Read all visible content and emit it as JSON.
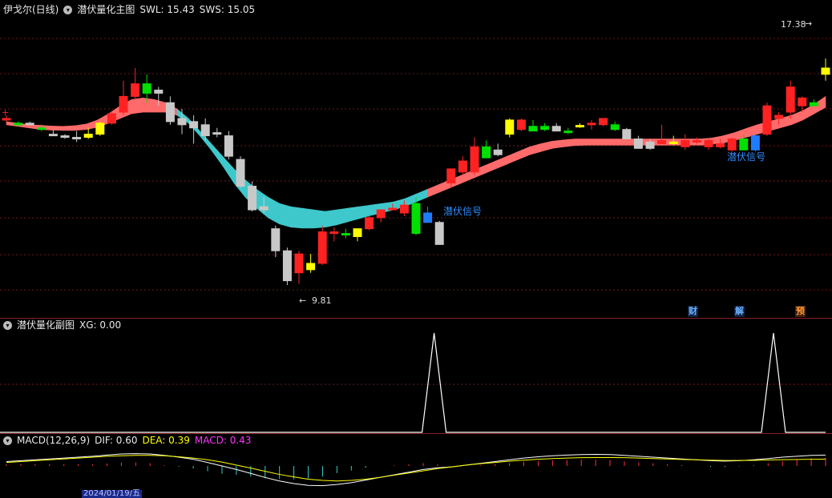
{
  "main_header": {
    "stock_name": "伊戈尔(日线)",
    "indicator_name": "潜伏量化主图",
    "swl_label": "SWL: 15.43",
    "sws_label": "SWS: 15.05"
  },
  "sub_header": {
    "indicator_name": "潜伏量化副图",
    "xg_label": "XG: 0.00"
  },
  "macd_header": {
    "name": "MACD(12,26,9)",
    "dif_label": "DIF: 0.60",
    "dea_label": "DEA: 0.39",
    "macd_label": "MACD: 0.43"
  },
  "annotations": {
    "high_label": "17.38",
    "low_label": "9.81",
    "signal_1": "潜伏信号",
    "signal_2": "潜伏信号"
  },
  "badges": [
    "财",
    "解",
    "预"
  ],
  "bottom_date": "2024/01/19/五",
  "colors": {
    "up": "#ff2222",
    "down": "#c8c8c8",
    "yellow": "#ffff00",
    "green": "#00e000",
    "blue": "#1e7cff",
    "ribbon_up": "#ff6b6b",
    "ribbon_down": "#3ec8cc",
    "signal_text": "#2e8cff"
  },
  "chart_data": {
    "type": "candlestick",
    "price_range": [
      9.0,
      18.3
    ],
    "candles": [
      {
        "o": 15.1,
        "h": 15.2,
        "l": 15.0,
        "c": 15.1,
        "col": "up"
      },
      {
        "o": 14.9,
        "h": 15.0,
        "l": 14.85,
        "c": 14.95,
        "col": "green"
      },
      {
        "o": 14.95,
        "h": 15.0,
        "l": 14.9,
        "c": 14.95,
        "col": "down"
      },
      {
        "o": 14.75,
        "h": 14.9,
        "l": 14.7,
        "c": 14.8,
        "col": "green"
      },
      {
        "o": 14.6,
        "h": 14.75,
        "l": 14.55,
        "c": 14.55,
        "col": "down"
      },
      {
        "o": 14.5,
        "h": 14.6,
        "l": 14.45,
        "c": 14.55,
        "col": "down"
      },
      {
        "o": 14.48,
        "h": 14.7,
        "l": 14.35,
        "c": 14.5,
        "col": "down"
      },
      {
        "o": 14.5,
        "h": 14.8,
        "l": 14.45,
        "c": 14.6,
        "col": "yellow"
      },
      {
        "o": 14.6,
        "h": 15.0,
        "l": 14.55,
        "c": 14.95,
        "col": "yellow"
      },
      {
        "o": 14.95,
        "h": 15.3,
        "l": 14.9,
        "c": 15.25,
        "col": "up"
      },
      {
        "o": 15.3,
        "h": 16.3,
        "l": 15.2,
        "c": 15.8,
        "col": "up"
      },
      {
        "o": 15.8,
        "h": 16.7,
        "l": 15.7,
        "c": 16.2,
        "col": "up"
      },
      {
        "o": 16.2,
        "h": 16.5,
        "l": 15.6,
        "c": 15.9,
        "col": "green"
      },
      {
        "o": 15.9,
        "h": 16.1,
        "l": 15.5,
        "c": 16.0,
        "col": "down"
      },
      {
        "o": 15.6,
        "h": 15.8,
        "l": 14.9,
        "c": 15.0,
        "col": "down"
      },
      {
        "o": 15.1,
        "h": 15.4,
        "l": 14.6,
        "c": 14.9,
        "col": "down"
      },
      {
        "o": 15.0,
        "h": 15.2,
        "l": 14.3,
        "c": 14.8,
        "col": "down"
      },
      {
        "o": 14.9,
        "h": 15.1,
        "l": 14.4,
        "c": 14.55,
        "col": "down"
      },
      {
        "o": 14.65,
        "h": 14.8,
        "l": 14.5,
        "c": 14.65,
        "col": "down"
      },
      {
        "o": 14.55,
        "h": 14.7,
        "l": 13.8,
        "c": 13.9,
        "col": "down"
      },
      {
        "o": 13.8,
        "h": 13.9,
        "l": 12.9,
        "c": 12.95,
        "col": "down"
      },
      {
        "o": 12.95,
        "h": 13.1,
        "l": 12.15,
        "c": 12.2,
        "col": "down"
      },
      {
        "o": 12.3,
        "h": 12.6,
        "l": 12.1,
        "c": 12.2,
        "col": "down"
      },
      {
        "o": 11.6,
        "h": 11.7,
        "l": 10.7,
        "c": 10.9,
        "col": "down"
      },
      {
        "o": 10.9,
        "h": 11.0,
        "l": 9.81,
        "c": 9.95,
        "col": "down"
      },
      {
        "o": 10.2,
        "h": 10.9,
        "l": 9.85,
        "c": 10.8,
        "col": "up"
      },
      {
        "o": 10.3,
        "h": 10.8,
        "l": 10.2,
        "c": 10.5,
        "col": "yellow"
      },
      {
        "o": 10.5,
        "h": 11.7,
        "l": 10.45,
        "c": 11.5,
        "col": "up"
      },
      {
        "o": 11.5,
        "h": 11.65,
        "l": 11.2,
        "c": 11.45,
        "col": "up"
      },
      {
        "o": 11.45,
        "h": 11.6,
        "l": 11.3,
        "c": 11.45,
        "col": "green"
      },
      {
        "o": 11.35,
        "h": 11.6,
        "l": 11.2,
        "c": 11.6,
        "col": "yellow"
      },
      {
        "o": 11.6,
        "h": 12.0,
        "l": 11.55,
        "c": 11.95,
        "col": "up"
      },
      {
        "o": 11.95,
        "h": 12.2,
        "l": 11.8,
        "c": 12.2,
        "col": "up"
      },
      {
        "o": 12.25,
        "h": 12.4,
        "l": 12.2,
        "c": 12.25,
        "col": "up"
      },
      {
        "o": 12.1,
        "h": 12.5,
        "l": 12.0,
        "c": 12.35,
        "col": "up"
      },
      {
        "o": 12.4,
        "h": 12.6,
        "l": 11.4,
        "c": 11.45,
        "col": "green"
      },
      {
        "o": 12.1,
        "h": 12.3,
        "l": 11.8,
        "c": 11.8,
        "col": "blue"
      },
      {
        "o": 11.8,
        "h": 11.85,
        "l": 11.1,
        "c": 11.1,
        "col": "down"
      },
      {
        "o": 13.05,
        "h": 13.5,
        "l": 12.9,
        "c": 13.5,
        "col": "up"
      },
      {
        "o": 13.4,
        "h": 13.9,
        "l": 13.3,
        "c": 13.75,
        "col": "up"
      },
      {
        "o": 13.4,
        "h": 14.5,
        "l": 13.3,
        "c": 14.2,
        "col": "up"
      },
      {
        "o": 14.2,
        "h": 14.4,
        "l": 13.9,
        "c": 13.85,
        "col": "green"
      },
      {
        "o": 14.1,
        "h": 14.3,
        "l": 13.9,
        "c": 13.95,
        "col": "down"
      },
      {
        "o": 14.6,
        "h": 15.1,
        "l": 14.5,
        "c": 15.05,
        "col": "yellow"
      },
      {
        "o": 14.75,
        "h": 15.1,
        "l": 14.7,
        "c": 15.05,
        "col": "up"
      },
      {
        "o": 14.85,
        "h": 15.05,
        "l": 14.7,
        "c": 14.7,
        "col": "green"
      },
      {
        "o": 14.85,
        "h": 14.95,
        "l": 14.7,
        "c": 14.75,
        "col": "green"
      },
      {
        "o": 14.85,
        "h": 14.95,
        "l": 14.7,
        "c": 14.7,
        "col": "down"
      },
      {
        "o": 14.7,
        "h": 14.8,
        "l": 14.6,
        "c": 14.7,
        "col": "green"
      },
      {
        "o": 14.88,
        "h": 14.95,
        "l": 14.8,
        "c": 14.85,
        "col": "yellow"
      },
      {
        "o": 14.9,
        "h": 15.05,
        "l": 14.75,
        "c": 14.95,
        "col": "up"
      },
      {
        "o": 14.9,
        "h": 15.1,
        "l": 14.85,
        "c": 15.1,
        "col": "up"
      },
      {
        "o": 14.9,
        "h": 15.0,
        "l": 14.7,
        "c": 14.75,
        "col": "green"
      },
      {
        "o": 14.75,
        "h": 14.8,
        "l": 14.45,
        "c": 14.45,
        "col": "down"
      },
      {
        "o": 14.45,
        "h": 14.55,
        "l": 14.15,
        "c": 14.15,
        "col": "down"
      },
      {
        "o": 14.35,
        "h": 14.45,
        "l": 14.1,
        "c": 14.15,
        "col": "down"
      },
      {
        "o": 14.4,
        "h": 14.9,
        "l": 14.3,
        "c": 14.3,
        "col": "up"
      },
      {
        "o": 14.35,
        "h": 14.55,
        "l": 14.25,
        "c": 14.3,
        "col": "yellow"
      },
      {
        "o": 14.2,
        "h": 14.6,
        "l": 14.1,
        "c": 14.4,
        "col": "up"
      },
      {
        "o": 14.4,
        "h": 14.5,
        "l": 14.3,
        "c": 14.4,
        "col": "up"
      },
      {
        "o": 14.2,
        "h": 14.45,
        "l": 14.1,
        "c": 14.4,
        "col": "up"
      },
      {
        "o": 14.3,
        "h": 14.45,
        "l": 14.15,
        "c": 14.2,
        "col": "up"
      },
      {
        "o": 14.1,
        "h": 14.5,
        "l": 14.05,
        "c": 14.45,
        "col": "up"
      },
      {
        "o": 14.45,
        "h": 14.6,
        "l": 14.1,
        "c": 14.1,
        "col": "green"
      },
      {
        "o": 14.1,
        "h": 14.6,
        "l": 14.05,
        "c": 14.55,
        "col": "blue"
      },
      {
        "o": 14.6,
        "h": 15.6,
        "l": 14.55,
        "c": 15.5,
        "col": "up"
      },
      {
        "o": 15.1,
        "h": 15.3,
        "l": 14.9,
        "c": 15.2,
        "col": "up"
      },
      {
        "o": 15.3,
        "h": 16.3,
        "l": 15.1,
        "c": 16.1,
        "col": "up"
      },
      {
        "o": 15.5,
        "h": 15.8,
        "l": 15.3,
        "c": 15.75,
        "col": "up"
      },
      {
        "o": 15.6,
        "h": 15.7,
        "l": 15.5,
        "c": 15.5,
        "col": "green"
      },
      {
        "o": 16.5,
        "h": 17.0,
        "l": 16.3,
        "c": 16.7,
        "col": "yellow"
      },
      {
        "o": 16.3,
        "h": 17.38,
        "l": 16.0,
        "c": 17.3,
        "col": "up"
      },
      {
        "o": 17.0,
        "h": 17.38,
        "l": 16.7,
        "c": 17.0,
        "col": "up"
      }
    ],
    "ribbon": {
      "swl_points": [
        15.0,
        14.95,
        14.9,
        14.88,
        14.86,
        14.85,
        14.87,
        14.92,
        15.05,
        15.25,
        15.5,
        15.7,
        15.75,
        15.7,
        15.6,
        15.4,
        15.1,
        14.7,
        14.3,
        13.9,
        13.5,
        13.15,
        12.85,
        12.6,
        12.4,
        12.3,
        12.25,
        12.2,
        12.15,
        12.2,
        12.25,
        12.3,
        12.35,
        12.4,
        12.45,
        12.55,
        12.7,
        12.85,
        13.0,
        13.15,
        13.3,
        13.45,
        13.6,
        13.75,
        13.9,
        14.05,
        14.2,
        14.3,
        14.38,
        14.42,
        14.45,
        14.45,
        14.45,
        14.45,
        14.45,
        14.45,
        14.45,
        14.45,
        14.45,
        14.45,
        14.45,
        14.45,
        14.48,
        14.55,
        14.65,
        14.78,
        14.9,
        15.0,
        15.1,
        15.2,
        15.35,
        15.55,
        15.8
      ],
      "sws_points": [
        14.9,
        14.85,
        14.8,
        14.75,
        14.73,
        14.72,
        14.72,
        14.75,
        14.82,
        14.95,
        15.1,
        15.25,
        15.3,
        15.3,
        15.3,
        15.2,
        14.95,
        14.55,
        14.1,
        13.6,
        13.05,
        12.6,
        12.25,
        11.95,
        11.75,
        11.65,
        11.62,
        11.62,
        11.65,
        11.72,
        11.82,
        11.92,
        12.02,
        12.1,
        12.2,
        12.3,
        12.45,
        12.6,
        12.75,
        12.9,
        13.05,
        13.2,
        13.35,
        13.5,
        13.65,
        13.8,
        13.95,
        14.05,
        14.15,
        14.2,
        14.24,
        14.25,
        14.25,
        14.25,
        14.25,
        14.25,
        14.25,
        14.25,
        14.25,
        14.25,
        14.25,
        14.25,
        14.28,
        14.32,
        14.4,
        14.5,
        14.6,
        14.7,
        14.8,
        14.9,
        15.05,
        15.25,
        15.45
      ]
    },
    "xg_spikes": [
      36,
      65
    ],
    "macd": {
      "dif": [
        0.25,
        0.3,
        0.35,
        0.4,
        0.45,
        0.5,
        0.55,
        0.62,
        0.68,
        0.7,
        0.68,
        0.6,
        0.5,
        0.38,
        0.2,
        0.0,
        -0.2,
        -0.42,
        -0.65,
        -0.85,
        -1.0,
        -1.1,
        -1.12,
        -1.05,
        -0.95,
        -0.8,
        -0.65,
        -0.5,
        -0.35,
        -0.2,
        -0.1,
        -0.05,
        0.05,
        0.15,
        0.25,
        0.35,
        0.45,
        0.52,
        0.58,
        0.62,
        0.65,
        0.66,
        0.65,
        0.6,
        0.55,
        0.5,
        0.45,
        0.4,
        0.35,
        0.3,
        0.28,
        0.3,
        0.35,
        0.42,
        0.5,
        0.55,
        0.6,
        0.62
      ],
      "dea": [
        0.2,
        0.25,
        0.3,
        0.35,
        0.4,
        0.45,
        0.5,
        0.55,
        0.58,
        0.6,
        0.6,
        0.58,
        0.52,
        0.45,
        0.35,
        0.22,
        0.05,
        -0.12,
        -0.3,
        -0.48,
        -0.62,
        -0.75,
        -0.82,
        -0.85,
        -0.82,
        -0.75,
        -0.65,
        -0.52,
        -0.4,
        -0.28,
        -0.15,
        -0.05,
        0.05,
        0.13,
        0.2,
        0.27,
        0.33,
        0.38,
        0.42,
        0.45,
        0.47,
        0.48,
        0.48,
        0.47,
        0.45,
        0.42,
        0.4,
        0.37,
        0.35,
        0.33,
        0.31,
        0.31,
        0.32,
        0.34,
        0.36,
        0.37,
        0.38,
        0.39
      ]
    }
  }
}
